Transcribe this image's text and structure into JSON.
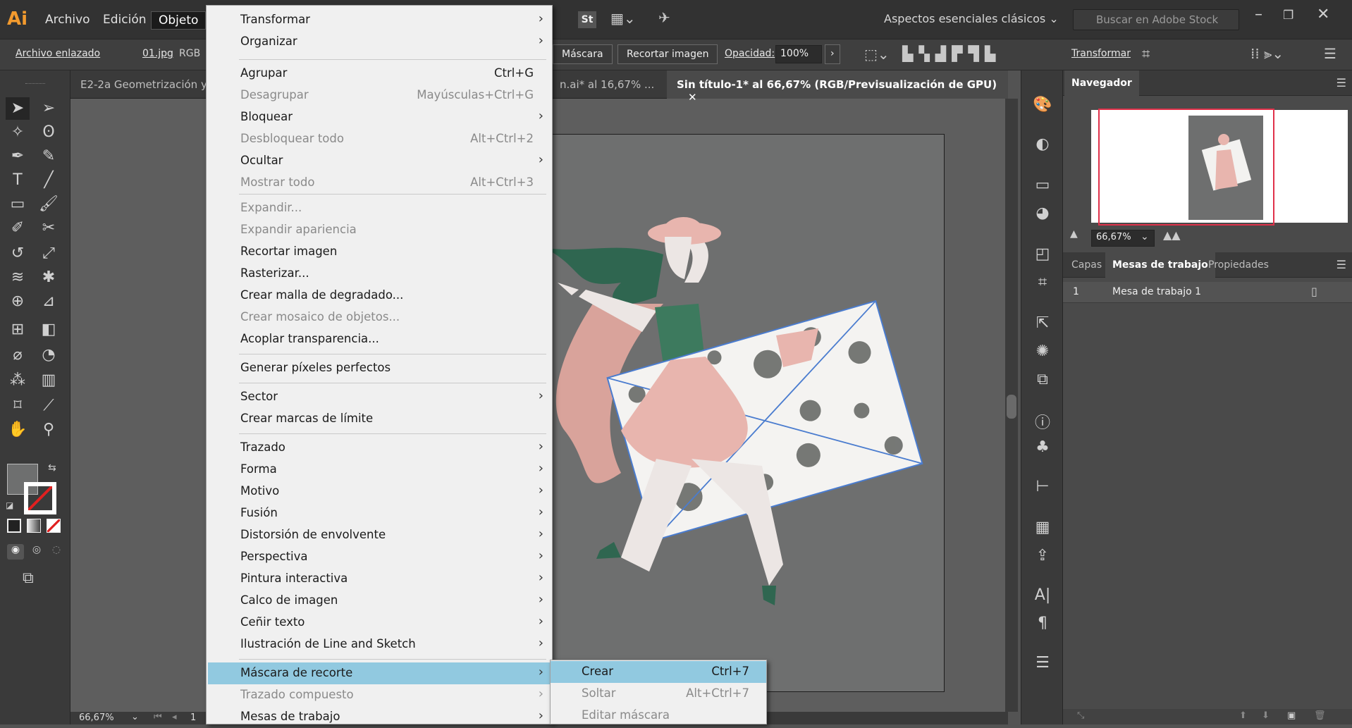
{
  "menubar": {
    "logo": "Ai",
    "items": [
      "Archivo",
      "Edición",
      "Objeto"
    ],
    "workspace": "Aspectos esenciales clásicos",
    "search_placeholder": "Buscar en Adobe Stock",
    "stock_badge": "St"
  },
  "controlbar": {
    "linked_file": "Archivo enlazado",
    "filename": "01.jpg",
    "colormode": "RGB",
    "mask_button": "Máscara",
    "crop_button": "Recortar imagen",
    "opacity_label": "Opacidad:",
    "opacity_value": "100%",
    "transform_label": "Transformar"
  },
  "tabs": [
    {
      "label": "E2-2a Geometrización y"
    },
    {
      "label": "n.ai* al 16,67% ..."
    },
    {
      "label": "Sin título-1* al 66,67% (RGB/Previsualización de GPU)"
    }
  ],
  "menu": {
    "items": [
      {
        "label": "Transformar",
        "shortcut": "",
        "submenu": true,
        "disabled": false
      },
      {
        "label": "Organizar",
        "shortcut": "",
        "submenu": true,
        "disabled": false
      },
      {
        "label": "Agrupar",
        "shortcut": "Ctrl+G",
        "submenu": false,
        "disabled": false
      },
      {
        "label": "Desagrupar",
        "shortcut": "Mayúsculas+Ctrl+G",
        "submenu": false,
        "disabled": true
      },
      {
        "label": "Bloquear",
        "shortcut": "",
        "submenu": true,
        "disabled": false
      },
      {
        "label": "Desbloquear todo",
        "shortcut": "Alt+Ctrl+2",
        "submenu": false,
        "disabled": true
      },
      {
        "label": "Ocultar",
        "shortcut": "",
        "submenu": true,
        "disabled": false
      },
      {
        "label": "Mostrar todo",
        "shortcut": "Alt+Ctrl+3",
        "submenu": false,
        "disabled": true
      },
      {
        "label": "Expandir...",
        "shortcut": "",
        "submenu": false,
        "disabled": true
      },
      {
        "label": "Expandir apariencia",
        "shortcut": "",
        "submenu": false,
        "disabled": true
      },
      {
        "label": "Recortar imagen",
        "shortcut": "",
        "submenu": false,
        "disabled": false
      },
      {
        "label": "Rasterizar...",
        "shortcut": "",
        "submenu": false,
        "disabled": false
      },
      {
        "label": "Crear malla de degradado...",
        "shortcut": "",
        "submenu": false,
        "disabled": false
      },
      {
        "label": "Crear mosaico de objetos...",
        "shortcut": "",
        "submenu": false,
        "disabled": true
      },
      {
        "label": "Acoplar transparencia...",
        "shortcut": "",
        "submenu": false,
        "disabled": false
      },
      {
        "label": "Generar píxeles perfectos",
        "shortcut": "",
        "submenu": false,
        "disabled": false
      },
      {
        "label": "Sector",
        "shortcut": "",
        "submenu": true,
        "disabled": false
      },
      {
        "label": "Crear marcas de límite",
        "shortcut": "",
        "submenu": false,
        "disabled": false
      },
      {
        "label": "Trazado",
        "shortcut": "",
        "submenu": true,
        "disabled": false
      },
      {
        "label": "Forma",
        "shortcut": "",
        "submenu": true,
        "disabled": false
      },
      {
        "label": "Motivo",
        "shortcut": "",
        "submenu": true,
        "disabled": false
      },
      {
        "label": "Fusión",
        "shortcut": "",
        "submenu": true,
        "disabled": false
      },
      {
        "label": "Distorsión de envolvente",
        "shortcut": "",
        "submenu": true,
        "disabled": false
      },
      {
        "label": "Perspectiva",
        "shortcut": "",
        "submenu": true,
        "disabled": false
      },
      {
        "label": "Pintura interactiva",
        "shortcut": "",
        "submenu": true,
        "disabled": false
      },
      {
        "label": "Calco de imagen",
        "shortcut": "",
        "submenu": true,
        "disabled": false
      },
      {
        "label": "Ceñir texto",
        "shortcut": "",
        "submenu": true,
        "disabled": false
      },
      {
        "label": "Ilustración de Line and Sketch",
        "shortcut": "",
        "submenu": true,
        "disabled": false
      },
      {
        "label": "Máscara de recorte",
        "shortcut": "",
        "submenu": true,
        "disabled": false,
        "highlighted": true
      },
      {
        "label": "Trazado compuesto",
        "shortcut": "",
        "submenu": true,
        "disabled": true
      },
      {
        "label": "Mesas de trabajo",
        "shortcut": "",
        "submenu": true,
        "disabled": false
      }
    ]
  },
  "submenu": {
    "items": [
      {
        "label": "Crear",
        "shortcut": "Ctrl+7",
        "disabled": false,
        "highlighted": true
      },
      {
        "label": "Soltar",
        "shortcut": "Alt+Ctrl+7",
        "disabled": true
      },
      {
        "label": "Editar máscara",
        "shortcut": "",
        "disabled": true
      }
    ]
  },
  "navigator": {
    "title": "Navegador",
    "zoom": "66,67%"
  },
  "layers_panel": {
    "tabs": [
      "Capas",
      "Mesas de trabajo",
      "Propiedades"
    ],
    "rows": [
      {
        "index": "1",
        "name": "Mesa de trabajo 1"
      }
    ]
  },
  "status": {
    "zoom": "66,67%",
    "page": "1"
  },
  "colors": {
    "accent_highlight": "#91c9e0",
    "logo_orange": "#f29a2e",
    "art_pink": "#e8b5ae",
    "art_green": "#3d7a5e"
  }
}
